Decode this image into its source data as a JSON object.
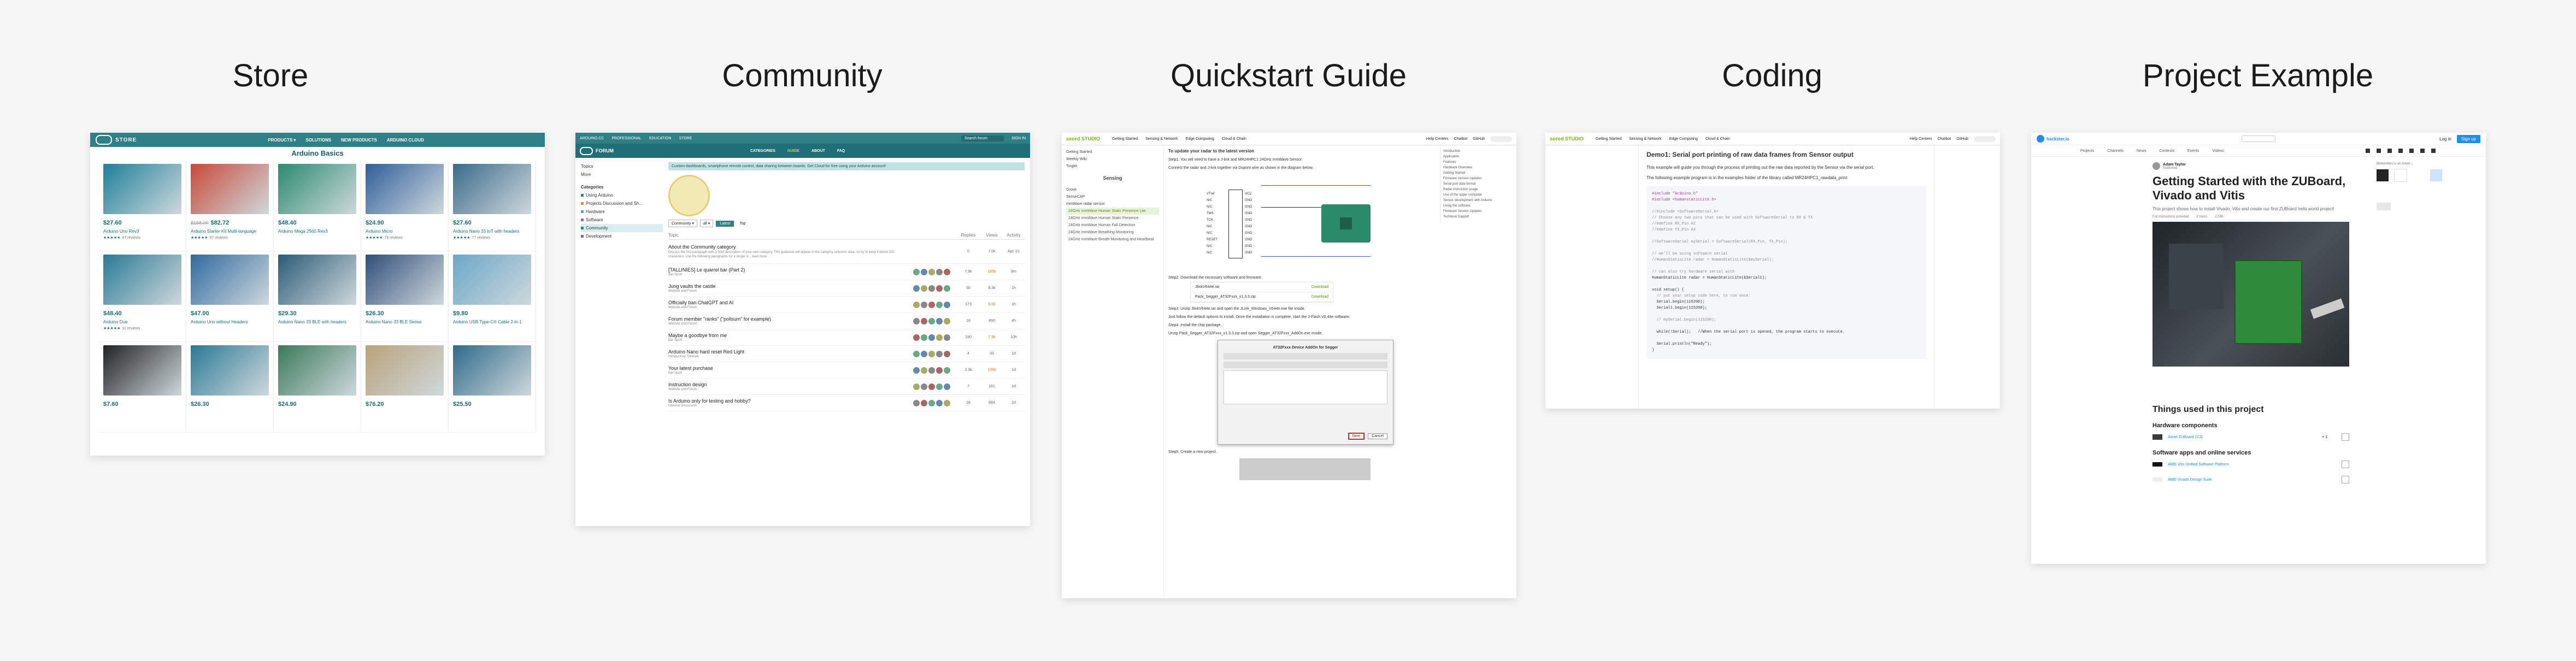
{
  "columns": [
    {
      "title": "Store"
    },
    {
      "title": "Community"
    },
    {
      "title": "Quickstart Guide"
    },
    {
      "title": "Coding"
    },
    {
      "title": "Project Example"
    }
  ],
  "store": {
    "nav": [
      "PRODUCTS ▾",
      "SOLUTIONS",
      "NEW PRODUCTS",
      "ARDUINO CLOUD"
    ],
    "store_label": "STORE",
    "section_title": "Arduino Basics",
    "products": [
      {
        "price": "$27.60",
        "name": "Arduino Uno Rev3",
        "reviews": "47 reviews"
      },
      {
        "price_old": "$158.00",
        "price": "$82.72",
        "name": "Arduino Starter Kit Multi-language",
        "reviews": "57 reviews"
      },
      {
        "price": "$48.40",
        "name": "Arduino Mega 2560 Rev3",
        "reviews": ""
      },
      {
        "price": "$24.90",
        "name": "Arduino Micro",
        "reviews": "76 reviews"
      },
      {
        "price": "$27.60",
        "name": "Arduino Nano 33 IoT with headers",
        "reviews": "77 reviews"
      },
      {
        "price": "$48.40",
        "name": "Arduino Due",
        "reviews": "11 reviews"
      },
      {
        "price": "$47.00",
        "name": "Arduino Uno without Headers",
        "reviews": ""
      },
      {
        "price": "$29.30",
        "name": "Arduino Nano 33 BLE with headers",
        "reviews": ""
      },
      {
        "price": "$26.30",
        "name": "Arduino Nano 33 BLE Sense",
        "reviews": ""
      },
      {
        "price": "$9.80",
        "name": "Arduino USB Type-C® Cable 2-in-1",
        "reviews": ""
      },
      {
        "price": "$7.60",
        "name": "",
        "reviews": ""
      },
      {
        "price": "$26.30",
        "name": "",
        "reviews": ""
      },
      {
        "price": "$24.90",
        "name": "",
        "reviews": ""
      },
      {
        "price": "$76.20",
        "name": "",
        "reviews": ""
      },
      {
        "price": "$25.50",
        "name": "",
        "reviews": ""
      }
    ]
  },
  "community": {
    "top_links": [
      "ARDUINO.CC",
      "PROFESSIONAL",
      "EDUCATION",
      "STORE"
    ],
    "forum_label": "FORUM",
    "search_placeholder": "Search forum",
    "sign_in": "SIGN IN",
    "tabs": [
      "CATEGORIES",
      "GUIDE",
      "ABOUT",
      "FAQ"
    ],
    "sidebar": [
      "Topics",
      "More",
      "Categories",
      "Using Arduino",
      "Projects Discussion and Sh...",
      "Hardware",
      "Software",
      "Community",
      "Development"
    ],
    "banner": "Custom dashboards, smartphone remote control, data sharing between boards. Get Cloud for free using your Arduino account!",
    "filters": [
      "Community ▾",
      "all ▾",
      "Latest",
      "Top"
    ],
    "col_headers": [
      "Topic",
      "Replies",
      "Views",
      "Activity"
    ],
    "topics": [
      {
        "title": "About the Community category",
        "sub": "Discuss the first paragraph with a brief description of your new category. This guidance will appear in the category selection area, so try to keep it below 200 characters. Use the following paragraphs for a longer d... read more",
        "replies": "0",
        "views": "7.0k",
        "activity": "Apr '21"
      },
      {
        "title": "[TALLINIES] Le quarrel bar (Part 2)",
        "sub": "Bar Sport",
        "replies": "7.9k",
        "views": "165k",
        "activity": "9m"
      },
      {
        "title": "Jung vaults the castle",
        "sub": "Website and Forum",
        "replies": "50",
        "views": "8.3k",
        "activity": "1h"
      },
      {
        "title": "Officially ban ChatGPT and AI",
        "sub": "Website and Forum",
        "replies": "173",
        "views": "9.0k",
        "activity": "1h"
      },
      {
        "title": "Forum member \"ranks\" (\"pollsum\" for example)",
        "sub": "Website and Forum",
        "replies": "18",
        "views": "490",
        "activity": "4h"
      },
      {
        "title": "Maybe a goodbye from me",
        "sub": "Bar Sport",
        "replies": "190",
        "views": "7.9k",
        "activity": "10h"
      },
      {
        "title": "Arduino Nano hard reset Red Light",
        "sub": "Introductory Tutorials",
        "replies": "4",
        "views": "33",
        "activity": "1d"
      },
      {
        "title": "Your latest purchase",
        "sub": "Bar Sport",
        "replies": "2.0k",
        "views": "100k",
        "activity": "1d"
      },
      {
        "title": "Instruction design",
        "sub": "Website and Forum",
        "replies": "7",
        "views": "181",
        "activity": "1d"
      },
      {
        "title": "Is Arduino only for testing and hobby?",
        "sub": "General Discussion",
        "replies": "28",
        "views": "684",
        "activity": "2d"
      }
    ]
  },
  "quickstart": {
    "brand": "seeed STUDIO",
    "nav": [
      "Getting Started",
      "Sensing & Network",
      "Edge Computing",
      "Cloud & Chain"
    ],
    "nav_right": [
      "Help Centers",
      "Chatbot",
      "GitHub"
    ],
    "sidebar": [
      "Getting Started",
      "Weekly Wiki",
      "Tingkit",
      "Sensing",
      "Grove",
      "SenseCAP",
      "mmWave radar sensor",
      "24GHz mmWave Human Static Presence Lite",
      "24GHz mmWave Human Static Presence",
      "24GHz mmWave Human Fall Detection",
      "24GHz mmWave Breathing Monitoring",
      "24GHz mmWave Breath Monitoring and Heartbeat"
    ],
    "heading": "To update your radar to the latest version",
    "steps": [
      "Step1. You will need to have a J-link and MR24HPC1 24GHz mmWave Sensor.",
      "Connect the radar and J-link together via Dupont wire as shown in the diagram below.",
      "Step2. Download the necessary software and firmware.",
      "Step3. Unzip JlinkV644e.rar and open the JLink_Windows_V644e.exe file inside.",
      "Just follow the default options to install. Once the installation is complete, start the J-Flash V6.44e software.",
      "Step4. Install the chip package.",
      "Unzip Pack_Segger_AT32Fxxx_v1.3.3.zip and open Segger_AT32Fxxx_AddOn.exe inside.",
      "Step5. Create a new project."
    ],
    "files": [
      {
        "name": "JlinkV644e.rar",
        "action": "Download"
      },
      {
        "name": "Pack_Segger_AT32Fxxx_v1.3.3.zip",
        "action": "Download"
      }
    ],
    "pins_left": [
      "VTref",
      "N/C",
      "N/C",
      "TMS",
      "TCK",
      "N/C",
      "N/C",
      "RESET",
      "N/C",
      "N/C"
    ],
    "pins_right": [
      "VCC",
      "GND",
      "GND",
      "GND",
      "GND",
      "GND",
      "GND",
      "GND",
      "GND",
      "GND"
    ],
    "dialog_title": "AT32Fxxx Device AddOn for Segger",
    "dialog_ok": "Next",
    "dialog_cancel": "Cancel",
    "toc": [
      "Introduction",
      "Application",
      "Features",
      "Hardware Overview",
      "Getting Started",
      "Firmware Version Updates",
      "Serial port data format",
      "Radar instruction usage",
      "Use of the upper computer",
      "Sensor development with Arduino",
      "Using the software",
      "Firmware Version Updates",
      "Technical Support"
    ]
  },
  "coding": {
    "brand": "seeed STUDIO",
    "nav": [
      "Getting Started",
      "Sensing & Network",
      "Edge Computing",
      "Cloud & Chain"
    ],
    "nav_right": [
      "Help Centers",
      "Chatbot",
      "GitHub"
    ],
    "title": "Demo1: Serial port printing of raw data frames from Sensor output",
    "para1": "This example will guide you through the process of printing out the raw data reported by the Sensor via the serial port.",
    "para2": "The following example program is in the examples folder of the library called MR24HPC1_rawdata_print",
    "code": [
      "#include \"Arduino.h\"",
      "#include <humanstaticLite.h>",
      "",
      "//#include <SoftwareSerial.h>",
      "// Choose any two pins that can be used with SoftwareSerial to RX & TX",
      "//#define RX_Pin A2",
      "//#define TX_Pin A3",
      "",
      "//SoftwareSerial mySerial = SoftwareSerial(RX_Pin, TX_Pin);",
      "",
      "// we'll be using software serial",
      "//HumanStaticLite radar = HumanStaticLite(&mySerial);",
      "",
      "// can also try hardware serial with",
      "HumanStaticLite radar = HumanStaticLite(&Serial1);",
      "",
      "void setup() {",
      "  // put your setup code here, to run once:",
      "  Serial.begin(115200);",
      "  Serial1.begin(115200);",
      "",
      "  // mySerial.begin(115200);",
      "",
      "  while(!Serial);   //When the serial port is opened, the program starts to execute.",
      "",
      "  Serial.println(\"Ready\");",
      "}"
    ]
  },
  "project": {
    "brand": "hackster.io",
    "nav_right": [
      "Log in",
      "Sign up"
    ],
    "nav_tabs": [
      "Projects",
      "Channels",
      "News",
      "Contests",
      "Events",
      "Videos"
    ],
    "author": "Adam Taylor",
    "author_sub": "Published",
    "title": "Getting Started with the ZUBoard, Vivado and Vitis",
    "desc": "This project shows how to install Vivado, Vitis and create our first ZUBoard hello world project!",
    "meta": [
      "Full instructions provided",
      "2 hours",
      "2,096"
    ],
    "things_heading": "Things used in this project",
    "hardware_heading": "Hardware components",
    "hardware": [
      {
        "name": "Avnet ZUBoard 1CG",
        "qty": "× 1"
      }
    ],
    "software_heading": "Software apps and online services",
    "software": [
      "AMD Vitis Unified Software Platform",
      "AMD Vivado Design Suite"
    ],
    "side_label": "Blinkenlites is an Avnet..."
  }
}
